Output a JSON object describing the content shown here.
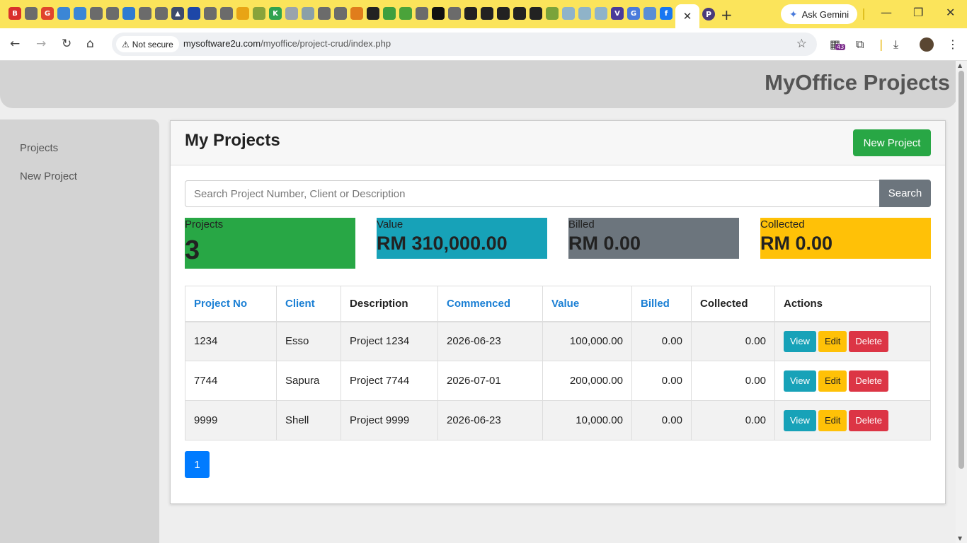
{
  "browser": {
    "active_tab_close": "✕",
    "new_tab": "+",
    "ask_gemini": "Ask Gemini",
    "not_secure": "Not secure",
    "url_host": "mysoftware2u.com",
    "url_path": "/myoffice/project-crud/index.php",
    "extension_badge": "43",
    "tab_favicons": [
      {
        "label": "B",
        "color": "#d9302c"
      },
      {
        "label": "",
        "color": "#6b6b6b"
      },
      {
        "label": "G",
        "color": "#e0452c"
      },
      {
        "label": "",
        "color": "#3b86d6"
      },
      {
        "label": "",
        "color": "#3b86d6"
      },
      {
        "label": "",
        "color": "#6b6b6b"
      },
      {
        "label": "",
        "color": "#6b6b6b"
      },
      {
        "label": "",
        "color": "#2f7bd1"
      },
      {
        "label": "",
        "color": "#6b6b6b"
      },
      {
        "label": "",
        "color": "#6b6b6b"
      },
      {
        "label": "▲",
        "color": "#3d4a6b"
      },
      {
        "label": "",
        "color": "#1d47a8"
      },
      {
        "label": "",
        "color": "#6b6b6b"
      },
      {
        "label": "",
        "color": "#6b6b6b"
      },
      {
        "label": "",
        "color": "#e8a415"
      },
      {
        "label": "",
        "color": "#88a33a"
      },
      {
        "label": "K",
        "color": "#2fa24f"
      },
      {
        "label": "",
        "color": "#9aa3ad"
      },
      {
        "label": "",
        "color": "#8aa0a8"
      },
      {
        "label": "",
        "color": "#6b6b6b"
      },
      {
        "label": "",
        "color": "#6b6b6b"
      },
      {
        "label": "",
        "color": "#e07d1c"
      },
      {
        "label": "",
        "color": "#222222"
      },
      {
        "label": "",
        "color": "#3e9f3e"
      },
      {
        "label": "",
        "color": "#4aa33a"
      },
      {
        "label": "",
        "color": "#6b6b6b"
      },
      {
        "label": "",
        "color": "#111111"
      },
      {
        "label": "",
        "color": "#6b6b6b"
      },
      {
        "label": "",
        "color": "#222222"
      },
      {
        "label": "",
        "color": "#222222"
      },
      {
        "label": "",
        "color": "#222222"
      },
      {
        "label": "",
        "color": "#222222"
      },
      {
        "label": "",
        "color": "#222222"
      },
      {
        "label": "",
        "color": "#7aa33a"
      },
      {
        "label": "",
        "color": "#8fb3c9"
      },
      {
        "label": "",
        "color": "#8fb3c9"
      },
      {
        "label": "",
        "color": "#8fb3c9"
      },
      {
        "label": "V",
        "color": "#4a3b9a"
      },
      {
        "label": "G",
        "color": "#4a7bdc"
      },
      {
        "label": "",
        "color": "#5a8ed6"
      },
      {
        "label": "f",
        "color": "#1877f2"
      }
    ],
    "after_tab_favicon": "P"
  },
  "site": {
    "brand": "MyOffice Projects"
  },
  "sidebar": {
    "items": [
      {
        "label": "Projects"
      },
      {
        "label": "New Project"
      }
    ]
  },
  "main": {
    "title": "My Projects",
    "new_button": "New Project",
    "search": {
      "placeholder": "Search Project Number, Client or Description",
      "button": "Search"
    },
    "stats": [
      {
        "label": "Projects",
        "value": "3",
        "color": "#28a745"
      },
      {
        "label": "Value",
        "value": "RM 310,000.00",
        "color": "#17a2b8"
      },
      {
        "label": "Billed",
        "value": "RM 0.00",
        "color": "#6c757d"
      },
      {
        "label": "Collected",
        "value": "RM 0.00",
        "color": "#ffc107"
      }
    ],
    "table": {
      "columns": [
        "Project No",
        "Client",
        "Description",
        "Commenced",
        "Value",
        "Billed",
        "Collected",
        "Actions"
      ],
      "rows": [
        {
          "no": "1234",
          "client": "Esso",
          "description": "Project 1234",
          "commenced": "2026-06-23",
          "value": "100,000.00",
          "billed": "0.00",
          "collected": "0.00"
        },
        {
          "no": "7744",
          "client": "Sapura",
          "description": "Project 7744",
          "commenced": "2026-07-01",
          "value": "200,000.00",
          "billed": "0.00",
          "collected": "0.00"
        },
        {
          "no": "9999",
          "client": "Shell",
          "description": "Project 9999",
          "commenced": "2026-06-23",
          "value": "10,000.00",
          "billed": "0.00",
          "collected": "0.00"
        }
      ],
      "actions": {
        "view": "View",
        "edit": "Edit",
        "delete": "Delete"
      }
    },
    "pagination": {
      "current": "1"
    }
  }
}
